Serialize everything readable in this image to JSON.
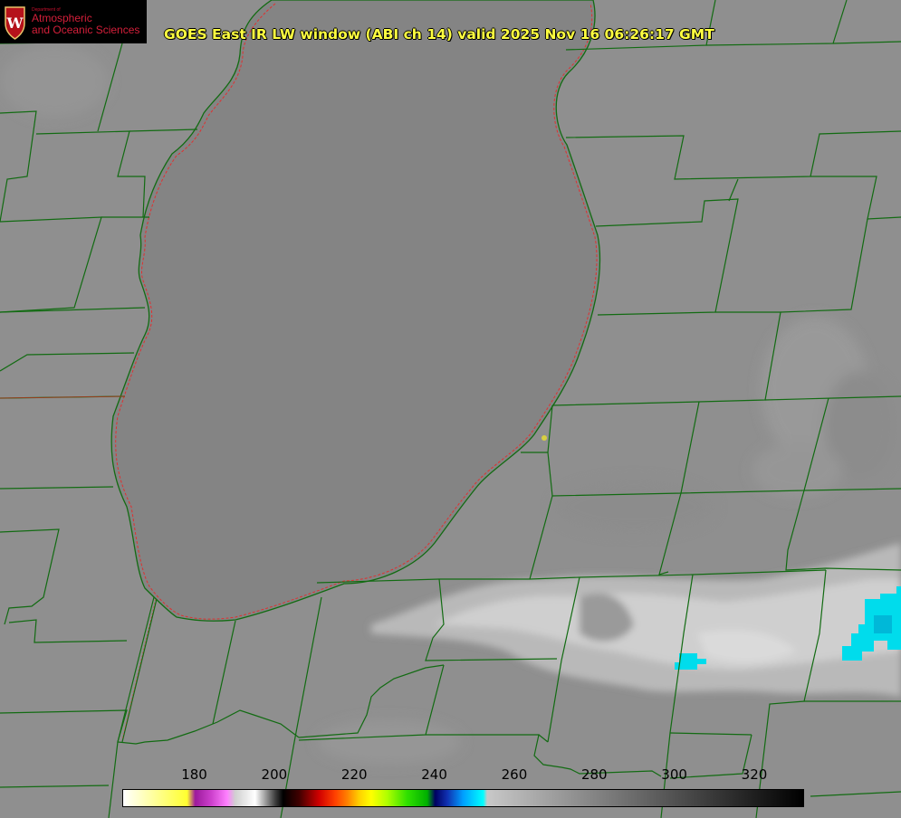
{
  "logo": {
    "department": "Department of",
    "line1": "Atmospheric",
    "line2": "and Oceanic Sciences",
    "crest_letter": "W",
    "crest_color": "#b5121b"
  },
  "title": "GOES East IR LW window (ABI ch 14) valid 2025 Nov 16 06:26:17 GMT",
  "colorbar": {
    "min": 162,
    "max": 332,
    "ticks": [
      180,
      200,
      220,
      240,
      260,
      280,
      300,
      320
    ],
    "stops": [
      {
        "value": 162,
        "color": "#ffffff"
      },
      {
        "value": 178,
        "color": "#ffff30"
      },
      {
        "value": 180,
        "color": "#9c1a9c"
      },
      {
        "value": 184,
        "color": "#cc40cc"
      },
      {
        "value": 188,
        "color": "#ff80ff"
      },
      {
        "value": 190,
        "color": "#d0d0d0"
      },
      {
        "value": 195,
        "color": "#ffffff"
      },
      {
        "value": 200,
        "color": "#404040"
      },
      {
        "value": 202,
        "color": "#000000"
      },
      {
        "value": 206,
        "color": "#400000"
      },
      {
        "value": 211,
        "color": "#d00000"
      },
      {
        "value": 215,
        "color": "#ff4000"
      },
      {
        "value": 218,
        "color": "#ff8000"
      },
      {
        "value": 221,
        "color": "#ffd000"
      },
      {
        "value": 224,
        "color": "#ffff00"
      },
      {
        "value": 228,
        "color": "#b0ff00"
      },
      {
        "value": 233,
        "color": "#30e000"
      },
      {
        "value": 238,
        "color": "#00b000"
      },
      {
        "value": 240,
        "color": "#000060"
      },
      {
        "value": 243,
        "color": "#1030b0"
      },
      {
        "value": 247,
        "color": "#00a0ff"
      },
      {
        "value": 252,
        "color": "#00ffff"
      },
      {
        "value": 253,
        "color": "#c8c8c8"
      },
      {
        "value": 332,
        "color": "#000000"
      }
    ]
  },
  "colors": {
    "land": "#8f8f8f",
    "lake": "#858585",
    "county_lines": "#126b12",
    "shoreline_dashed": "#e03030",
    "cold_cloud": "#00e0f0",
    "station_marker": "#d8d040"
  }
}
